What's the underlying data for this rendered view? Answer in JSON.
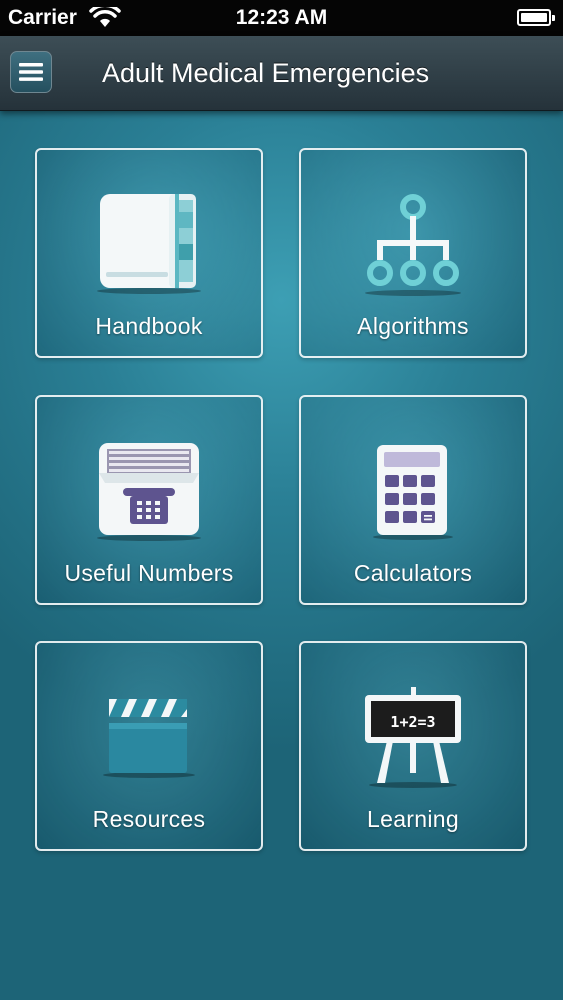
{
  "status_bar": {
    "carrier": "Carrier",
    "time": "12:23 AM",
    "wifi_icon": "wifi-icon",
    "battery_icon": "battery-icon"
  },
  "nav_bar": {
    "title": "Adult Medical Emergencies",
    "menu_icon": "hamburger-menu-icon"
  },
  "tiles": [
    {
      "label": "Handbook",
      "icon": "book-icon"
    },
    {
      "label": "Algorithms",
      "icon": "flowchart-icon"
    },
    {
      "label": "Useful Numbers",
      "icon": "phone-card-box-icon"
    },
    {
      "label": "Calculators",
      "icon": "calculator-icon"
    },
    {
      "label": "Resources",
      "icon": "clapperboard-icon"
    },
    {
      "label": "Learning",
      "icon": "chalkboard-icon"
    }
  ],
  "colors": {
    "background": "#2a7f95",
    "nav_bar": "#2f3d45",
    "tile_border": "#ffffff",
    "accent_teal": "#5ed0d8",
    "accent_purple": "#6a5f9e"
  },
  "chalkboard_text": "1+2=3"
}
